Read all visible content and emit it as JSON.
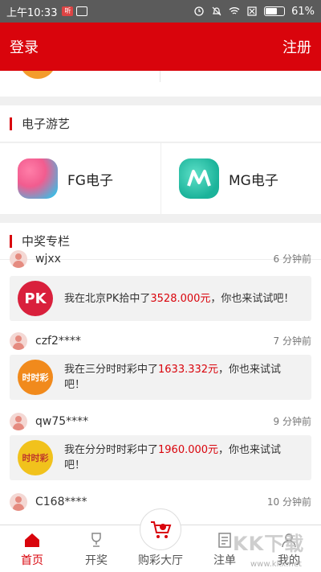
{
  "status_bar": {
    "time": "上午10:33",
    "battery": "61%"
  },
  "header": {
    "login": "登录",
    "register": "注册"
  },
  "section_games": {
    "title": "电子游艺"
  },
  "games": [
    {
      "name": "FG电子",
      "icon": "fg-logo-icon"
    },
    {
      "name": "MG电子",
      "icon": "mg-logo-icon"
    }
  ],
  "section_winners": {
    "title": "中奖专栏"
  },
  "winners": [
    {
      "user": "wjxx",
      "ago": "6 分钟前",
      "game": "北京PK拾",
      "msg_prefix": "我在北京PK拾中了",
      "amount": "3528.000元",
      "msg_suffix": "，你也来试试吧！",
      "icon_text": "PK"
    },
    {
      "user": "czf2****",
      "ago": "7 分钟前",
      "game": "三分时时彩",
      "msg_prefix": "我在三分时时彩中了",
      "amount": "1633.332元",
      "msg_suffix": "，你也来试试吧！",
      "icon_text": "时时彩"
    },
    {
      "user": "qw75****",
      "ago": "9 分钟前",
      "game": "分分时时彩",
      "msg_prefix": "我在分分时时彩中了",
      "amount": "1960.000元",
      "msg_suffix": "，你也来试试吧！",
      "icon_text": "时时彩"
    },
    {
      "user": "C168****",
      "ago": "10 分钟前"
    }
  ],
  "tabs": [
    {
      "label": "首页",
      "icon": "home-icon"
    },
    {
      "label": "开奖",
      "icon": "trophy-icon"
    },
    {
      "label": "购彩大厅",
      "icon": "cart-icon"
    },
    {
      "label": "注单",
      "icon": "list-icon"
    },
    {
      "label": "我的",
      "icon": "user-icon"
    }
  ],
  "watermark": {
    "text": "KK下载",
    "sub": "www.kkx.net"
  },
  "colors": {
    "brand_red": "#d9040c"
  }
}
